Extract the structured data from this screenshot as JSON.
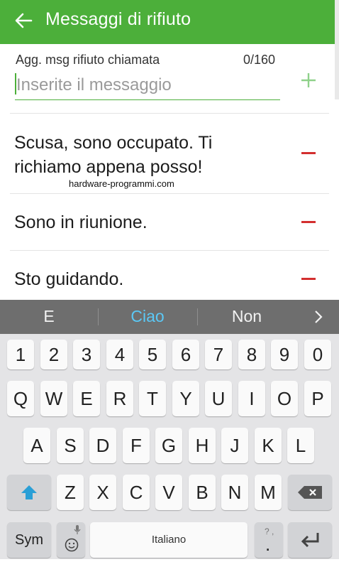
{
  "header": {
    "title": "Messaggi di rifiuto",
    "back_icon": "arrow-left-icon"
  },
  "input": {
    "label": "Agg. msg rifiuto chiamata",
    "counter": "0/160",
    "placeholder": "Inserite il messaggio",
    "value": ""
  },
  "messages": [
    "Scusa, sono occupato. Ti richiamo appena posso!",
    "Sono in riunione.",
    "Sto guidando."
  ],
  "watermark": "hardware-programmi.com",
  "keyboard": {
    "suggestions": [
      "E",
      "Ciao",
      "Non"
    ],
    "number_row": [
      "1",
      "2",
      "3",
      "4",
      "5",
      "6",
      "7",
      "8",
      "9",
      "0"
    ],
    "row1": [
      "Q",
      "W",
      "E",
      "R",
      "T",
      "Y",
      "U",
      "I",
      "O",
      "P"
    ],
    "row2": [
      "A",
      "S",
      "D",
      "F",
      "G",
      "H",
      "J",
      "K",
      "L"
    ],
    "row3": [
      "Z",
      "X",
      "C",
      "V",
      "B",
      "N",
      "M"
    ],
    "sym_label": "Sym",
    "space_label": "Italiano",
    "period_label": ".",
    "punct_hint": "? ,"
  },
  "colors": {
    "accent": "#4caf3a",
    "remove": "#d32f2f",
    "suggestion_highlight": "#5bc8f5",
    "shift": "#2a9fd6"
  }
}
